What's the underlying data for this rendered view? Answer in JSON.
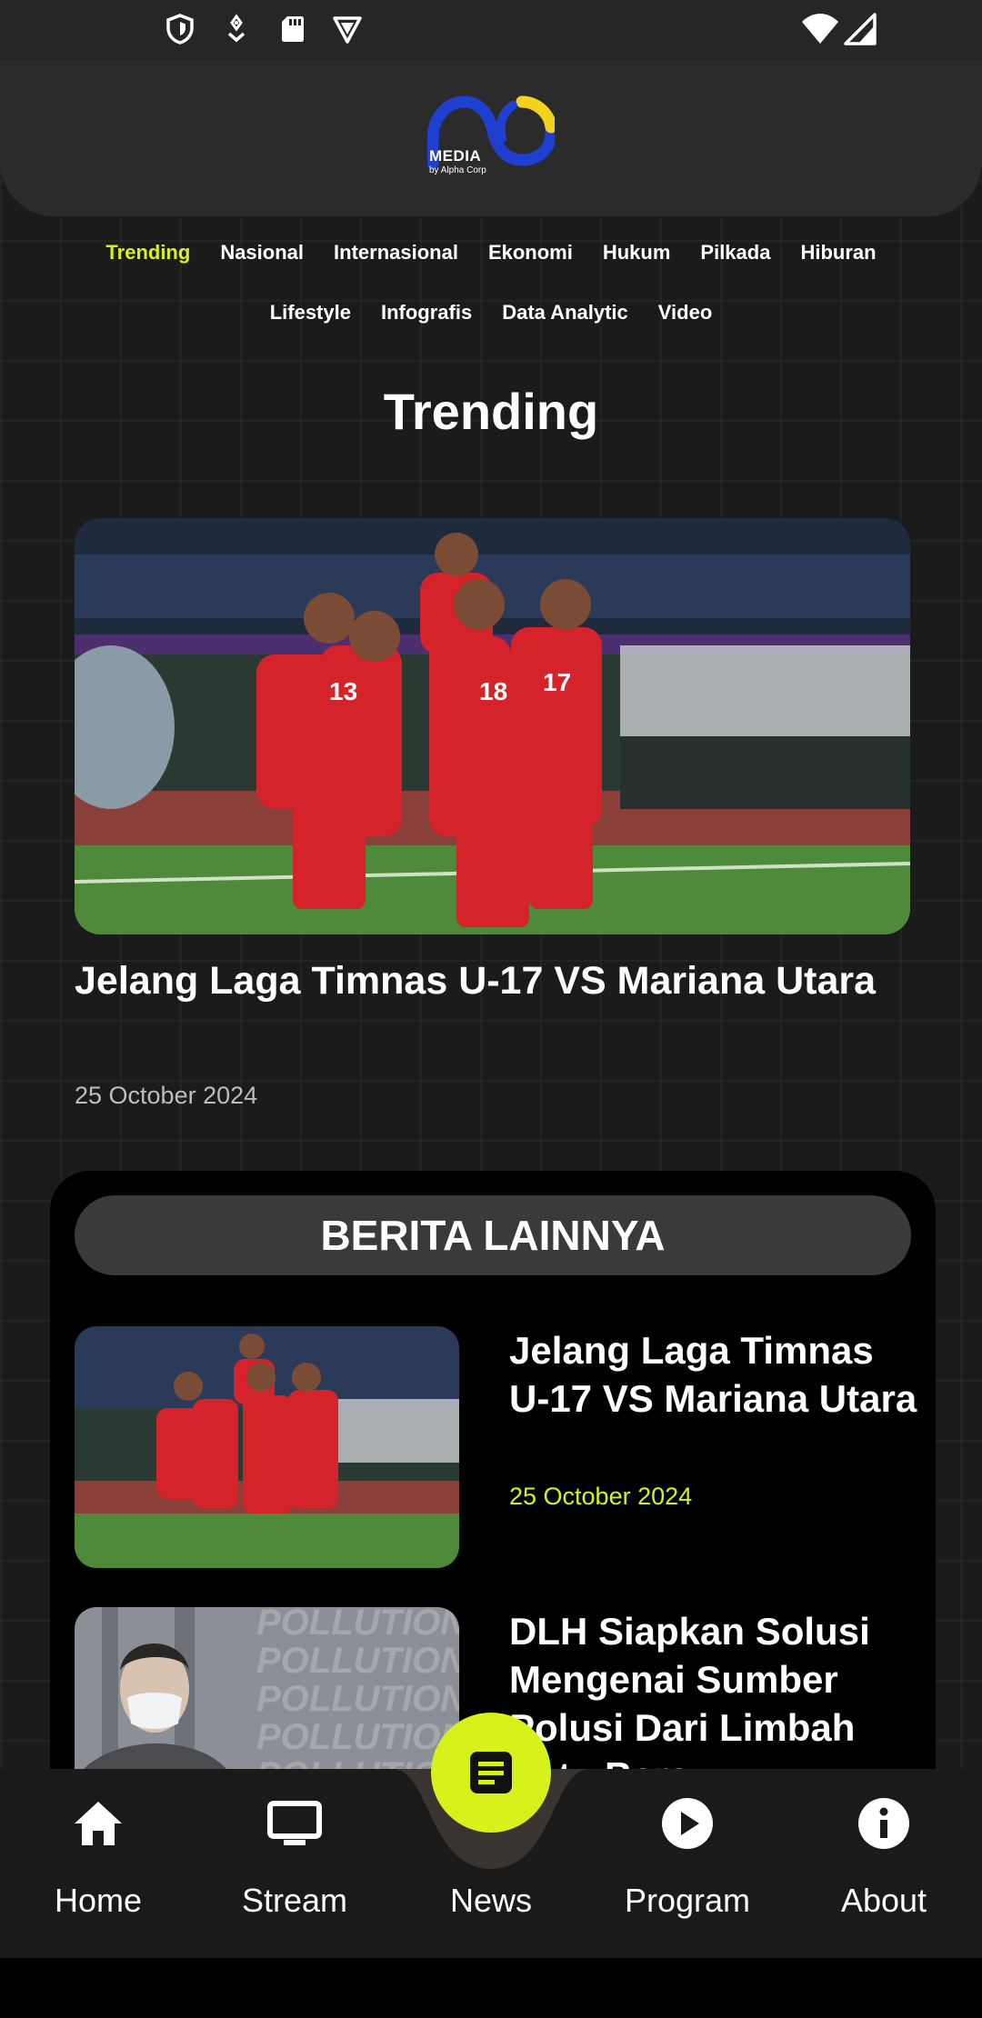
{
  "status_bar": {
    "icons": [
      "shield-icon",
      "vpn-key-icon",
      "sd-card-icon",
      "badge-icon",
      "wifi-icon",
      "signal-icon"
    ]
  },
  "header": {
    "logo_word": "MEDIA",
    "logo_sub": "by Alpha Corp"
  },
  "categories": {
    "row1": [
      "Trending",
      "Nasional",
      "Internasional",
      "Ekonomi",
      "Hukum",
      "Pilkada",
      "Hiburan"
    ],
    "row2": [
      "Lifestyle",
      "Infografis",
      "Data Analytic",
      "Video"
    ],
    "active": "Trending"
  },
  "section_title": "Trending",
  "hero": {
    "title": "Jelang Laga Timnas U-17 VS Mariana Utara",
    "date": "25 October 2024",
    "image": "football-team-celebration"
  },
  "more_news": {
    "header": "BERITA LAINNYA",
    "items": [
      {
        "title": "Jelang Laga Timnas U-17 VS Mariana Utara",
        "date": "25 October 2024",
        "image": "football-team-celebration"
      },
      {
        "title": "DLH Siapkan Solusi Mengenai Sumber Polusi Dari Limbah Batu Bara",
        "image": "pollution-woman-mask",
        "image_text": "POLLUTION"
      }
    ]
  },
  "bottom_nav": {
    "items": [
      {
        "label": "Home",
        "icon": "home-icon"
      },
      {
        "label": "Stream",
        "icon": "monitor-icon"
      },
      {
        "label": "News",
        "icon": "article-icon"
      },
      {
        "label": "Program",
        "icon": "play-circle-icon"
      },
      {
        "label": "About",
        "icon": "info-icon"
      }
    ],
    "active": "News"
  },
  "colors": {
    "accent": "#d7f21a",
    "header_bg": "#2b2b2b",
    "page_bg": "#1b1b1b"
  }
}
